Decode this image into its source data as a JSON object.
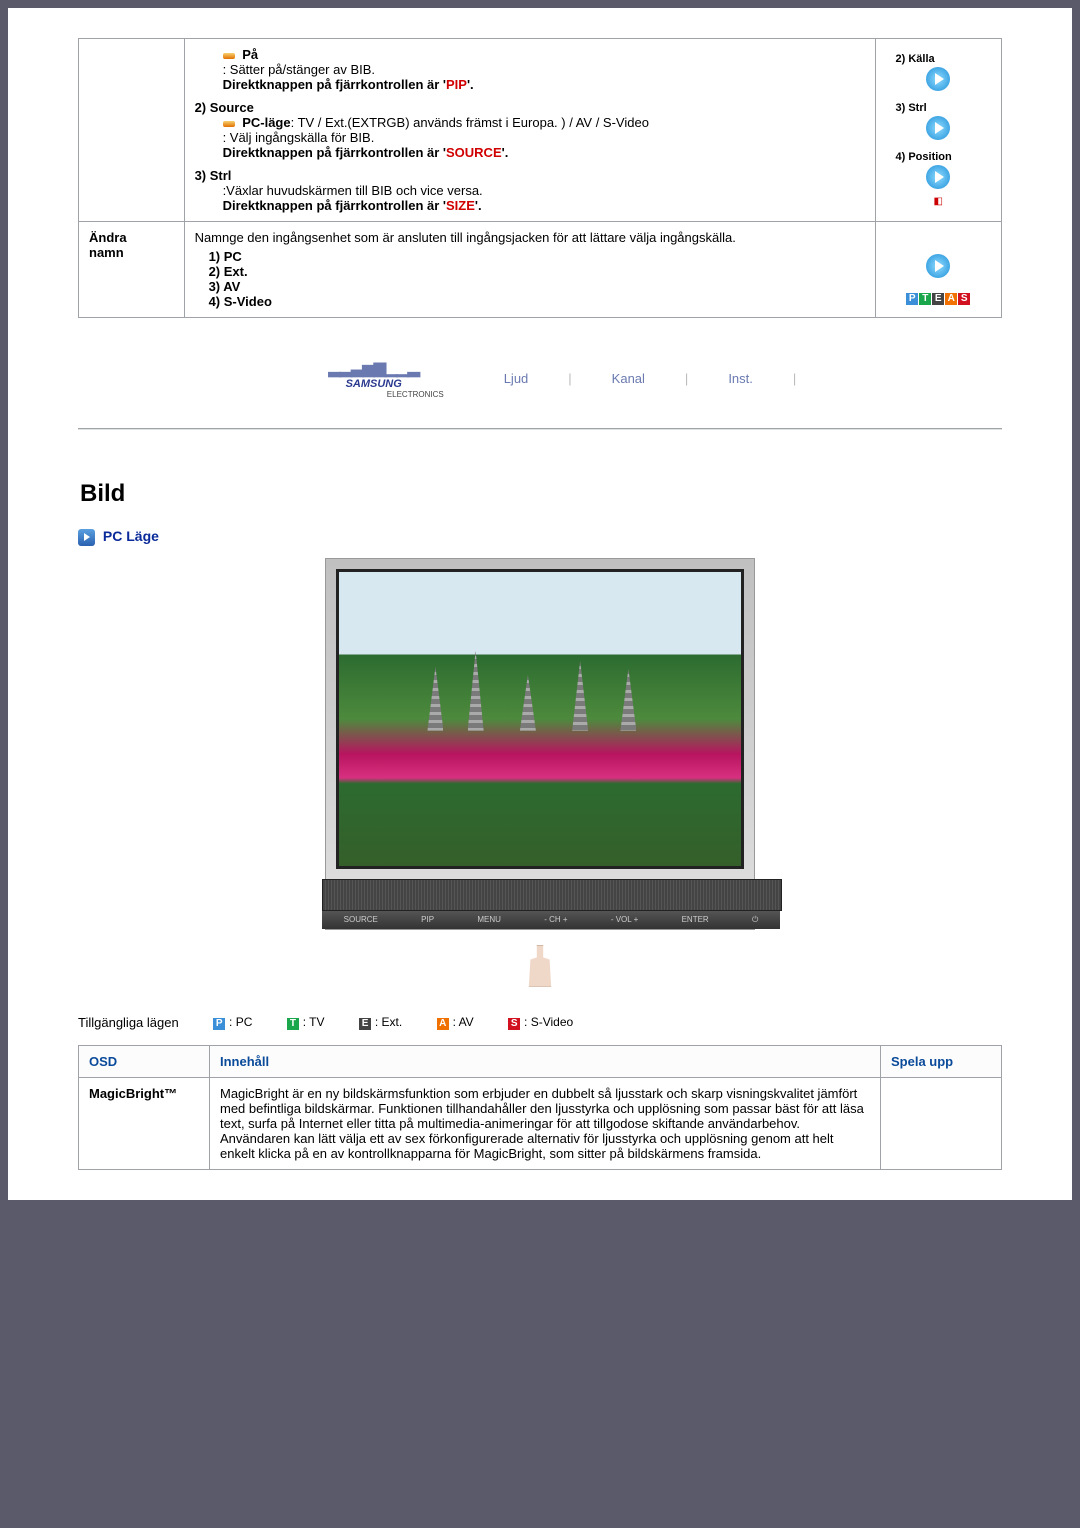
{
  "upper": {
    "row1": {
      "item_pa": "På",
      "pa_desc": ": Sätter på/stänger av BIB.",
      "pa_direct": "Direktknappen på fjärrkontrollen är 'PIP'.",
      "h_source": "2) Source",
      "source_pc": "PC-läge: TV / Ext.(EXTRGB) används främst i Europa. ) / AV / S-Video",
      "source_pick": ": Välj ingångskälla för BIB.",
      "source_direct": "Direktknappen på fjärrkontrollen är 'SOURCE'.",
      "h_strl": "3) Strl",
      "strl_desc": ":Växlar huvudskärmen till BIB och vice versa.",
      "strl_direct": "Direktknappen på fjärrkontrollen är 'SIZE'.",
      "side2": "2) Källa",
      "side3": "3) Strl",
      "side4": "4) Position"
    },
    "row2": {
      "label": "Ändra namn",
      "desc": "Namnge den ingångsenhet som är ansluten till ingångsjacken för att lättare välja ingångskälla.",
      "opt1": "1) PC",
      "opt2": "2) Ext.",
      "opt3": "3) AV",
      "opt4": "4) S-Video"
    }
  },
  "tabs": {
    "brand_name": "SAMSUNG",
    "brand_sub": "ELECTRONICS",
    "t1": "Ljud",
    "t2": "Kanal",
    "t3": "Inst."
  },
  "section_title": "Bild",
  "mode_title": "PC Läge",
  "monitor_buttons": [
    "SOURCE",
    "PIP",
    "MENU",
    "- CH +",
    "- VOL +",
    "ENTER",
    "⏻"
  ],
  "legend": {
    "label": "Tillgängliga lägen",
    "pc": ": PC",
    "tv": ": TV",
    "ext": ": Ext.",
    "av": ": AV",
    "sv": ": S-Video"
  },
  "lower": {
    "h_osd": "OSD",
    "h_content": "Innehåll",
    "h_play": "Spela upp",
    "row1_osd": "MagicBright™",
    "row1_content": "MagicBright är en ny bildskärmsfunktion som erbjuder en dubbelt så ljusstark och skarp visningskvalitet jämfört med befintliga bildskärmar. Funktionen tillhandahåller den ljusstyrka och upplösning som passar bäst för att läsa text, surfa på Internet eller titta på multimedia-animeringar för att tillgodose skiftande användarbehov. Användaren kan lätt välja ett av sex förkonfigurerade alternativ för ljusstyrka och upplösning genom att helt enkelt klicka på en av kontrollknapparna för MagicBright, som sitter på bildskärmens framsida."
  }
}
